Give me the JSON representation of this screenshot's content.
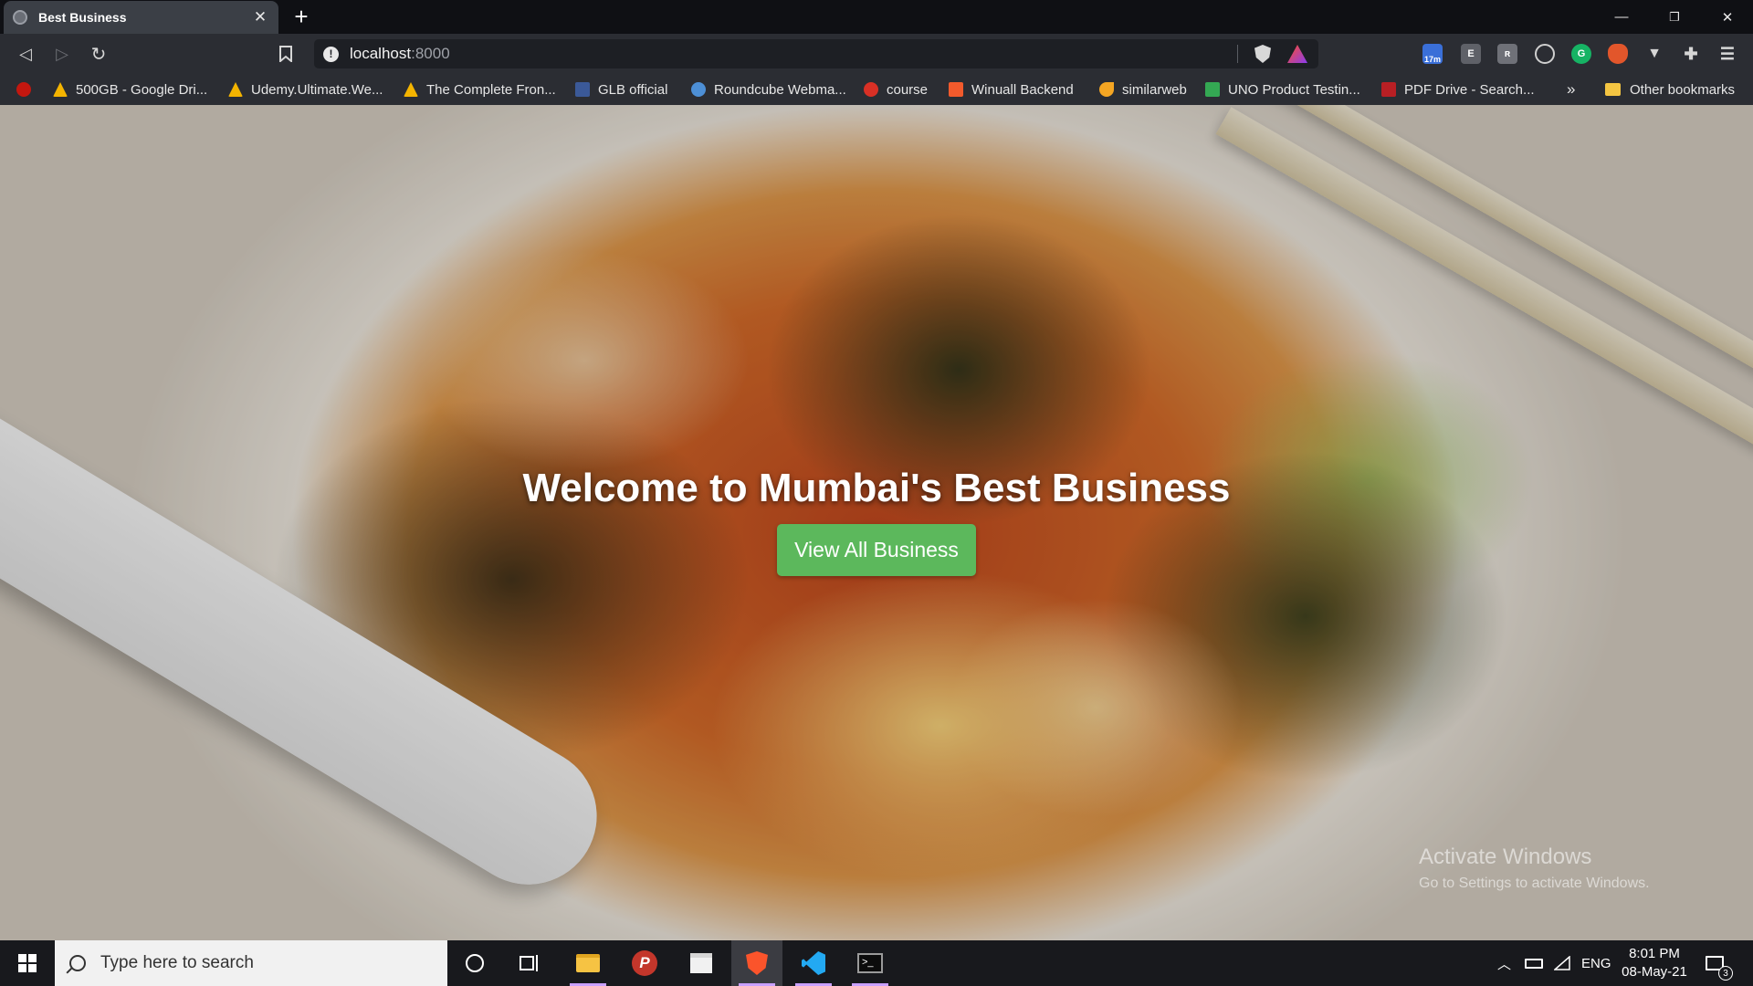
{
  "browser": {
    "tab_title": "Best Business",
    "tab_close": "✕",
    "new_tab": "+",
    "window_controls": {
      "minimize": "—",
      "restore": "❐",
      "close": "✕"
    },
    "url_host": "localhost",
    "url_port": ":8000",
    "extension_badge": "17m",
    "bookmarks": [
      {
        "label": "500GB - Google Dri...",
        "icon": "google-drive-icon",
        "color": "#f4b400"
      },
      {
        "label": "Udemy.Ultimate.We...",
        "icon": "google-drive-icon",
        "color": "#f4b400"
      },
      {
        "label": "The Complete Fron...",
        "icon": "google-drive-icon",
        "color": "#f4b400"
      },
      {
        "label": "GLB official",
        "icon": "facebook-icon",
        "color": "#3b5998"
      },
      {
        "label": "Roundcube Webma...",
        "icon": "roundcube-icon",
        "color": "#4d8fd6"
      },
      {
        "label": "course",
        "icon": "course-icon",
        "color": "#d93025"
      },
      {
        "label": "Winuall Backend",
        "icon": "winuall-icon",
        "color": "#f25a2c"
      },
      {
        "label": "similarweb",
        "icon": "similarweb-icon",
        "color": "#f5a623"
      },
      {
        "label": "UNO Product Testin...",
        "icon": "uno-icon",
        "color": "#34a853"
      },
      {
        "label": "PDF Drive - Search...",
        "icon": "pdf-drive-icon",
        "color": "#b81f24"
      }
    ],
    "bookmarks_overflow": "»",
    "other_bookmarks": "Other bookmarks"
  },
  "page": {
    "title": "Welcome to Mumbai's Best Business",
    "cta": "View All Business",
    "cta_color": "#5cb85c",
    "watermark_title": "Activate Windows",
    "watermark_subtitle": "Go to Settings to activate Windows."
  },
  "taskbar": {
    "search_placeholder": "Type here to search",
    "language": "ENG",
    "time": "8:01 PM",
    "date": "08-May-21",
    "notifications": "3"
  }
}
